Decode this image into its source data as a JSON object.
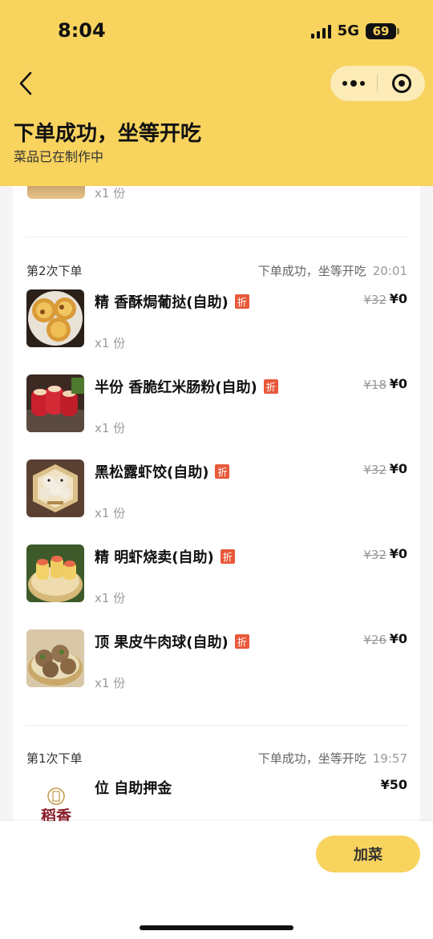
{
  "status_bar": {
    "time": "8:04",
    "network": "5G",
    "battery": "69"
  },
  "header": {
    "title": "下单成功，坐等开吃",
    "subtitle": "菜品已在制作中"
  },
  "partial_item": {
    "qty": "x1 份"
  },
  "rounds": [
    {
      "label": "第2次下单",
      "status": "下单成功，坐等开吃",
      "time": "20:01",
      "items": [
        {
          "name": "精 香酥焗葡挞(自助)",
          "badge": "折",
          "orig_price": "¥32",
          "price": "¥0",
          "qty": "x1 份"
        },
        {
          "name": "半份 香脆红米肠粉(自助)",
          "badge": "折",
          "orig_price": "¥18",
          "price": "¥0",
          "qty": "x1 份"
        },
        {
          "name": "黑松露虾饺(自助)",
          "badge": "折",
          "orig_price": "¥32",
          "price": "¥0",
          "qty": "x1 份"
        },
        {
          "name": "精 明虾烧卖(自助)",
          "badge": "折",
          "orig_price": "¥32",
          "price": "¥0",
          "qty": "x1 份"
        },
        {
          "name": "顶 果皮牛肉球(自助)",
          "badge": "折",
          "orig_price": "¥26",
          "price": "¥0",
          "qty": "x1 份"
        }
      ]
    },
    {
      "label": "第1次下单",
      "status": "下单成功，坐等开吃",
      "time": "19:57",
      "items": [
        {
          "name": "位 自助押金",
          "price": "¥50",
          "logo_text": "稻香"
        }
      ]
    }
  ],
  "bottom_bar": {
    "add_button": "加菜"
  },
  "colors": {
    "brand_yellow": "#f8d35e",
    "discount_red": "#e8583a"
  }
}
